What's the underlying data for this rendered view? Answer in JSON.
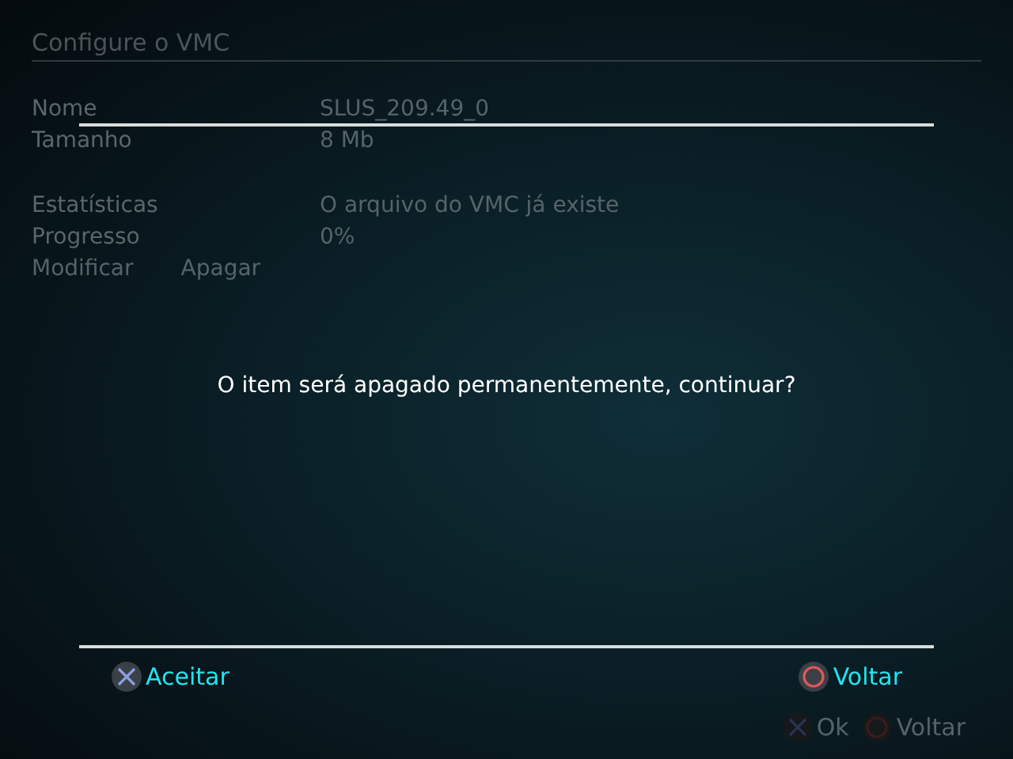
{
  "window": {
    "title": "Configure o VMC"
  },
  "info": [
    {
      "label": "Nome",
      "value": "SLUS_209.49_0"
    },
    {
      "label": "Tamanho",
      "value": "8 Mb"
    }
  ],
  "status": [
    {
      "label": "Estatísticas",
      "value": "O arquivo do VMC já existe"
    },
    {
      "label": "Progresso",
      "value": "0%"
    }
  ],
  "actions": [
    "Modificar",
    "Apagar"
  ],
  "dialog": {
    "message": "O item será apagado permanentemente, continuar?",
    "buttons": [
      {
        "kind": "cross",
        "label": "Aceitar"
      },
      {
        "kind": "circle",
        "label": "Voltar"
      }
    ]
  },
  "hints": [
    {
      "kind": "cross",
      "label": "Ok"
    },
    {
      "kind": "circle",
      "label": "Voltar"
    }
  ]
}
